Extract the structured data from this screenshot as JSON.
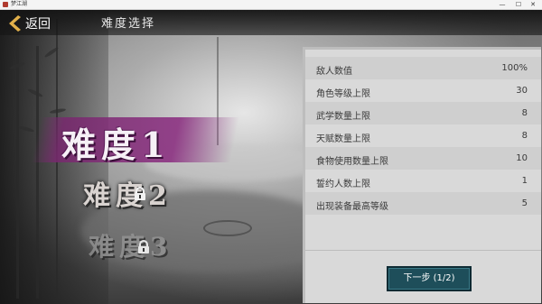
{
  "window": {
    "title": "梦江湖",
    "controls": [
      "—",
      "☐",
      "✕"
    ]
  },
  "header": {
    "back_label": "返回",
    "title": "难度选择"
  },
  "difficulties": [
    {
      "label": "难度1",
      "locked": false,
      "selected": true
    },
    {
      "label": "难度2",
      "locked": true,
      "selected": false
    },
    {
      "label": "难度3",
      "locked": true,
      "selected": false
    }
  ],
  "stats": [
    {
      "label": "敌人数值",
      "value": "100%"
    },
    {
      "label": "角色等级上限",
      "value": "30"
    },
    {
      "label": "武学数量上限",
      "value": "8"
    },
    {
      "label": "天赋数量上限",
      "value": "8"
    },
    {
      "label": "食物使用数量上限",
      "value": "10"
    },
    {
      "label": "誓约人数上限",
      "value": "1"
    },
    {
      "label": "出现装备最高等级",
      "value": "5"
    }
  ],
  "next_button": {
    "label": "下一步 (1/2)"
  },
  "colors": {
    "selected_banner": "#8c3282",
    "panel_bg": "#d9d9d9",
    "button_bg": "#1e4e5a"
  },
  "icons": [
    "back-chevron-icon",
    "lock-icon"
  ]
}
